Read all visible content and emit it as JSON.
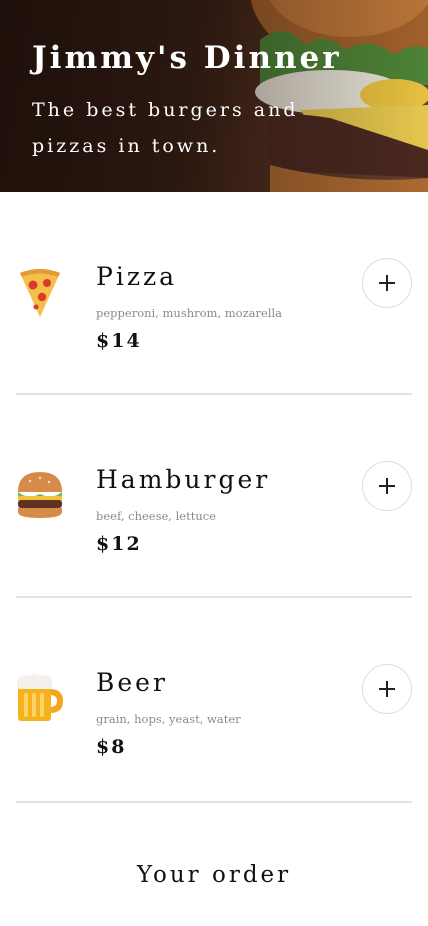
{
  "header": {
    "title": "Jimmy's Dinner",
    "subtitle": "The best burgers and pizzas in town."
  },
  "menu": {
    "items": [
      {
        "icon": "pizza-icon",
        "name": "Pizza",
        "ingredients": "pepperoni, mushrom, mozarella",
        "price": "$14",
        "add_icon": "plus-icon"
      },
      {
        "icon": "hamburger-icon",
        "name": "Hamburger",
        "ingredients": "beef, cheese, lettuce",
        "price": "$12",
        "add_icon": "plus-icon"
      },
      {
        "icon": "beer-icon",
        "name": "Beer",
        "ingredients": "grain, hops, yeast, water",
        "price": "$8",
        "add_icon": "plus-icon"
      }
    ]
  },
  "order": {
    "title": "Your order"
  },
  "colors": {
    "text": "#111111",
    "muted": "#8a8a8a",
    "divider": "#e3e3e3",
    "button_border": "#dcdcdc"
  }
}
